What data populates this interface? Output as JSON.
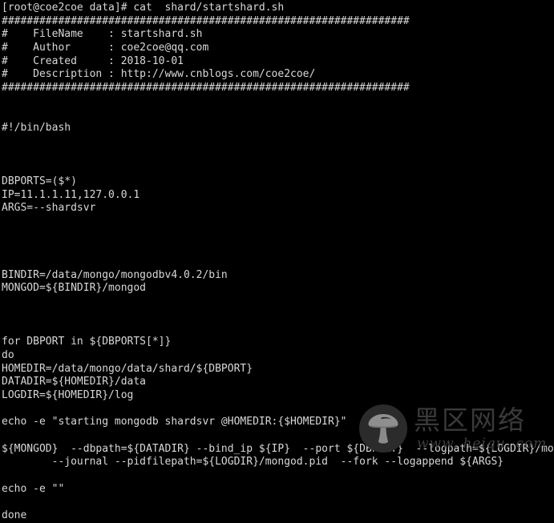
{
  "terminal": {
    "colors": {
      "background": "#000000",
      "foreground": "#d8d8d8",
      "watermark_badge": "#2b2b2b",
      "watermark_mushroom": "#8a8a8a",
      "watermark_text": "#3a3a3a"
    },
    "prompt": {
      "user": "root",
      "host": "coe2coe",
      "cwd": "data",
      "symbol": "#",
      "command": "cat  shard/startshard.sh",
      "full_line": "[root@coe2coe data]# cat  shard/startshard.sh"
    },
    "file": {
      "name": "startshard.sh",
      "header": {
        "rule": "#################################################################",
        "fields": [
          {
            "label": "FileName",
            "value": "startshard.sh"
          },
          {
            "label": "Author",
            "value": "coe2coe@qq.com"
          },
          {
            "label": "Created",
            "value": "2018-10-01"
          },
          {
            "label": "Description",
            "value": "http://www.cnblogs.com/coe2coe/"
          }
        ]
      },
      "shebang": "#!/bin/bash",
      "variables": [
        "DBPORTS=($*)",
        "IP=11.1.1.11,127.0.0.1",
        "ARGS=--shardsvr",
        "BINDIR=/data/mongo/mongodbv4.0.2/bin",
        "MONGOD=${BINDIR}/mongod"
      ],
      "loop": {
        "for": "for DBPORT in ${DBPORTS[*]}",
        "do": "do",
        "body": [
          "HOMEDIR=/data/mongo/data/shard/${DBPORT}",
          "DATADIR=${HOMEDIR}/data",
          "LOGDIR=${HOMEDIR}/log",
          "echo -e \"starting mongodb shardsvr @HOMEDIR:{$HOMEDIR}\"",
          "${MONGOD}  --dbpath=${DATADIR} --bind_ip ${IP}  --port ${DBPORT}  --logpath=${LOGDIR}/mongod.log\\",
          "        --journal --pidfilepath=${LOGDIR}/mongod.pid  --fork --logappend ${ARGS}",
          "echo -e \"\""
        ],
        "done": "done"
      }
    },
    "lines": [
      "[root@coe2coe data]# cat  shard/startshard.sh",
      "#################################################################",
      "#    FileName    : startshard.sh",
      "#    Author      : coe2coe@qq.com",
      "#    Created     : 2018-10-01",
      "#    Description : http://www.cnblogs.com/coe2coe/",
      "#################################################################",
      "",
      "",
      "#!/bin/bash",
      "",
      "",
      "",
      "DBPORTS=($*)",
      "IP=11.1.1.11,127.0.0.1",
      "ARGS=--shardsvr",
      "",
      "",
      "",
      "",
      "BINDIR=/data/mongo/mongodbv4.0.2/bin",
      "MONGOD=${BINDIR}/mongod",
      "",
      "",
      "",
      "for DBPORT in ${DBPORTS[*]}",
      "do",
      "HOMEDIR=/data/mongo/data/shard/${DBPORT}",
      "DATADIR=${HOMEDIR}/data",
      "LOGDIR=${HOMEDIR}/log",
      "",
      "echo -e \"starting mongodb shardsvr @HOMEDIR:{$HOMEDIR}\"",
      "",
      "${MONGOD}  --dbpath=${DATADIR} --bind_ip ${IP}  --port ${DBPORT}  --logpath=${LOGDIR}/mongod.log\\",
      "        --journal --pidfilepath=${LOGDIR}/mongod.pid  --fork --logappend ${ARGS}",
      "",
      "echo -e \"\"",
      "",
      "done"
    ]
  },
  "watermark": {
    "icon": "mushroom-icon",
    "cn_text": "黑区网络",
    "url_text": "www. heiqu. com"
  }
}
